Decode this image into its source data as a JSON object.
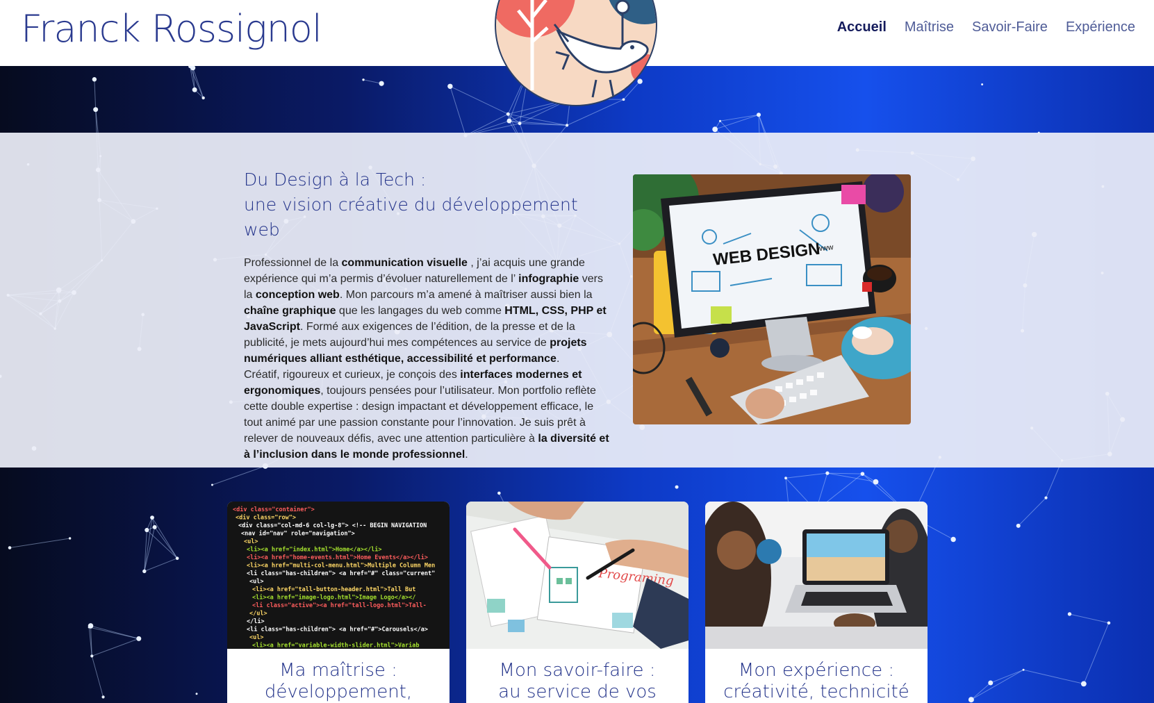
{
  "header": {
    "site_title": "Franck Rossignol",
    "nav": [
      {
        "label": "Accueil",
        "active": true
      },
      {
        "label": "Maîtrise",
        "active": false
      },
      {
        "label": "Savoir-Faire",
        "active": false
      },
      {
        "label": "Expérience",
        "active": false
      }
    ]
  },
  "intro": {
    "heading_line1": "Du Design à la Tech :",
    "heading_line2": "une vision créative du développement web",
    "image_caption": "WEB DESIGN",
    "image_caption_small": "www"
  },
  "cards": [
    {
      "title_line1": "Ma maîtrise :",
      "title_line2": "développement,"
    },
    {
      "title_line1": "Mon savoir-faire :",
      "title_line2": "au service de vos"
    },
    {
      "title_line1": "Mon expérience :",
      "title_line2": "créativité, technicité"
    }
  ],
  "code_lines": [
    "<div class=\"container\">",
    "  <div class=\"row\">",
    "    <div class=\"col-md-6 col-lg-8\"> <!-- BEGIN NAVIGATION",
    "      <nav id=\"nav\" role=\"navigation\">",
    "        <ul>",
    "          <li><a href=\"index.html\">Home</a></li>",
    "          <li><a href=\"home-events.html\">Home Events</a></li>",
    "          <li><a href=\"multi-col-menu.html\">Multiple Column Men",
    "          <li class=\"has-children\"> <a href=\"#\" class=\"current\"",
    "            <ul>",
    "              <li><a href=\"tall-button-header.html\">Tall But",
    "              <li><a href=\"image-logo.html\">Image Logo</a></",
    "              <li class=\"active\"><a href=\"tall-logo.html\">Tall-",
    "            </ul>",
    "          </li>",
    "          <li class=\"has-children\"> <a href=\"#\">Carousels</a>",
    "            <ul>",
    "              <li><a href=\"variable-width-slider.html\">Variab"
  ],
  "programming_word": "Programing",
  "colors": {
    "title": "#2a3a8f",
    "nav_active": "#141b5c",
    "nav": "#4f5c97",
    "heading": "#23338a",
    "background_blue": "#1650ec"
  }
}
